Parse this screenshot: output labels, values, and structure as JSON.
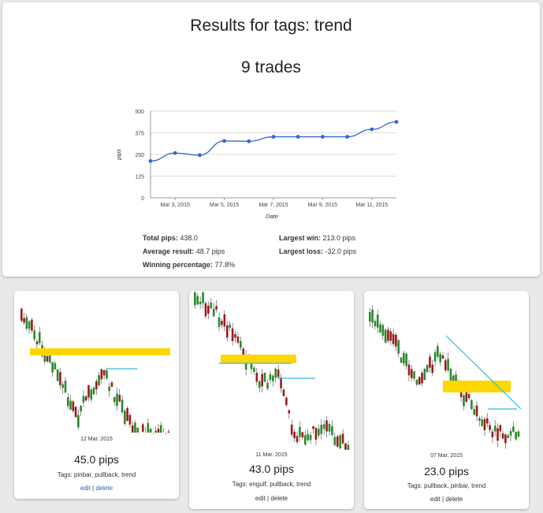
{
  "header": {
    "title": "Results for tags: trend",
    "trade_count": "9 trades"
  },
  "chart_data": {
    "type": "line",
    "x": [
      "Mar 2, 2015",
      "Mar 3, 2015",
      "Mar 4, 2015",
      "Mar 5, 2015",
      "Mar 6, 2015",
      "Mar 7, 2015",
      "Mar 8, 2015",
      "Mar 9, 2015",
      "Mar 10, 2015",
      "Mar 11, 2015",
      "Mar 12, 2015"
    ],
    "values": [
      212,
      258,
      246,
      328,
      326,
      352,
      352,
      352,
      352,
      395,
      438
    ],
    "x_tick_labels": [
      "Mar 3, 2015",
      "Mar 5, 2015",
      "Mar 7, 2015",
      "Mar 9, 2015",
      "Mar 11, 2015"
    ],
    "y_ticks": [
      0,
      125,
      250,
      375,
      500
    ],
    "ylim": [
      0,
      500
    ],
    "xlabel": "Date",
    "ylabel": "pips",
    "grid": true,
    "line_color": "#3366cc"
  },
  "stats": {
    "total_pips_label": "Total pips:",
    "total_pips": "438.0",
    "average_label": "Average result:",
    "average": "48.7 pips",
    "winning_label": "Winning percentage:",
    "winning": "77.8%",
    "largest_win_label": "Largest win:",
    "largest_win": "213.0 pips",
    "largest_loss_label": "Largest loss:",
    "largest_loss": "-32.0 pips"
  },
  "trades": [
    {
      "date": "12 Mar. 2015",
      "pips": "45.0 pips",
      "tags": "Tags: pinbar, pullback, trend",
      "edit": "edit",
      "sep": "|",
      "delete": "delete"
    },
    {
      "date": "11 Mar. 2015",
      "pips": "43.0 pips",
      "tags": "Tags: engulf, pullback, trend",
      "edit": "edit",
      "sep": "|",
      "delete": "delete"
    },
    {
      "date": "07 Mar. 2015",
      "pips": "23.0 pips",
      "tags": "Tags: pullback, pinbar, trend",
      "edit": "edit",
      "sep": "|",
      "delete": "delete"
    }
  ],
  "colors": {
    "bull": "#2a8a2a",
    "bear": "#9a1b1b",
    "zone": "#ffd700",
    "level": "#33bbdd",
    "link": "#2a66b8"
  }
}
